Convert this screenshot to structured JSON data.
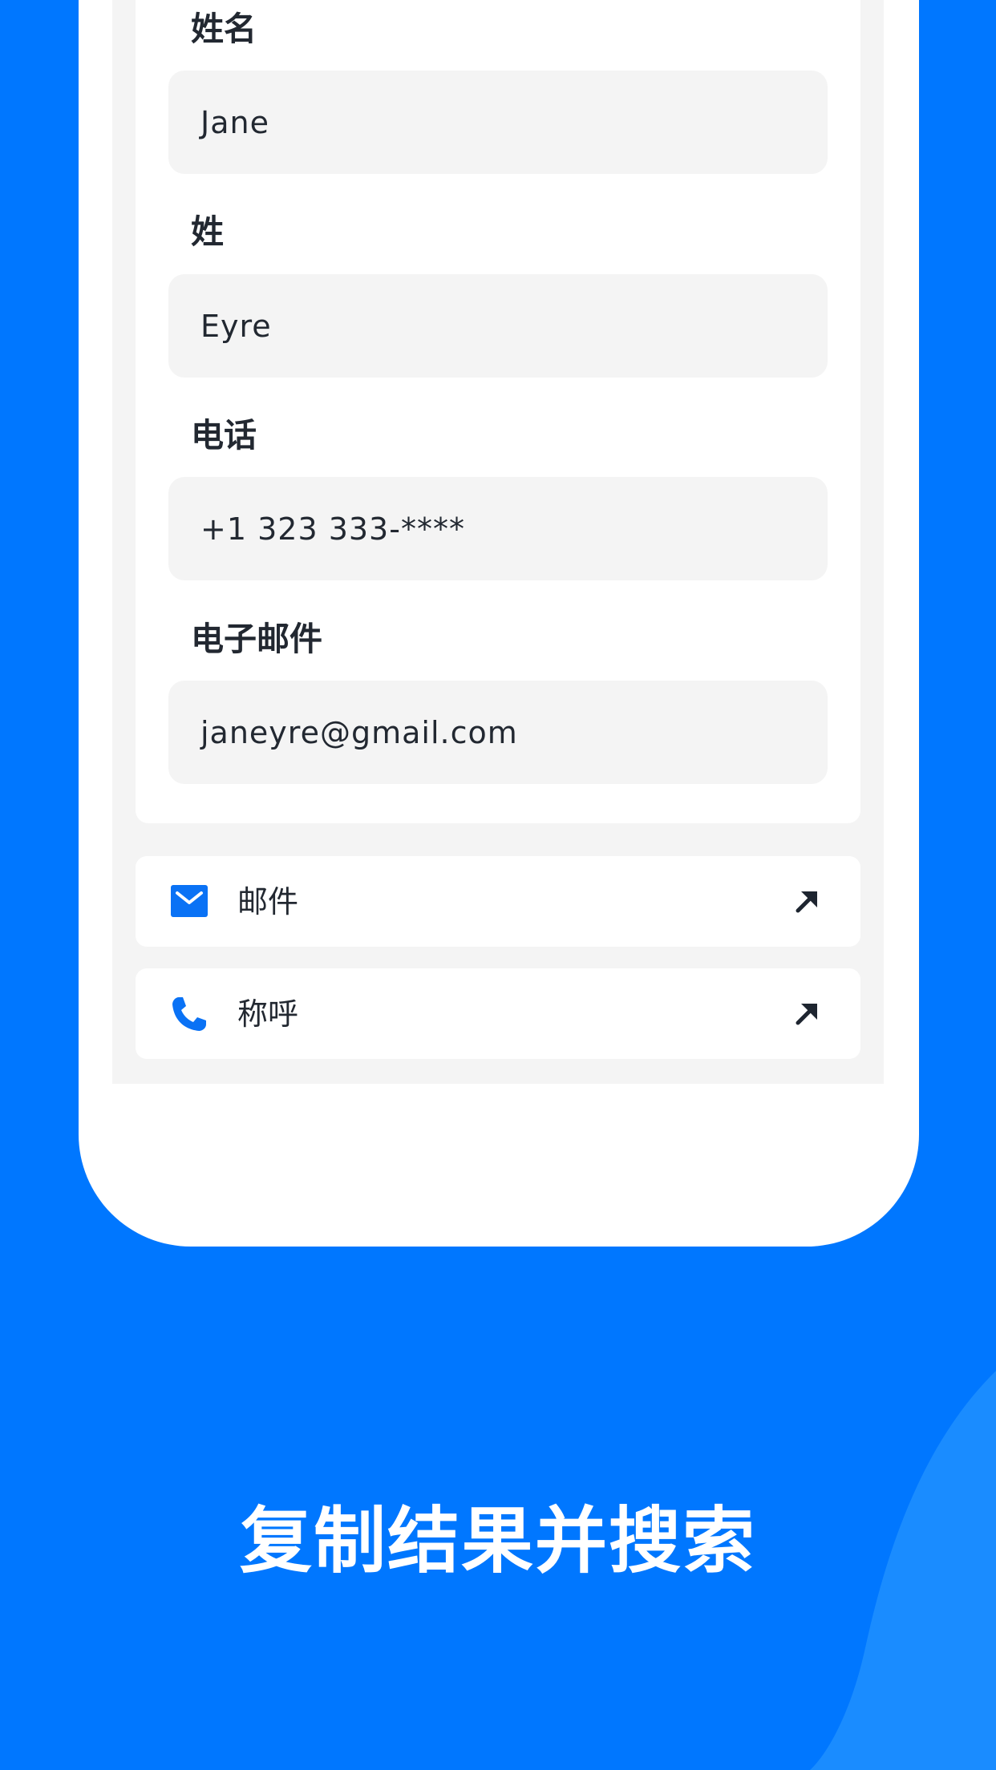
{
  "colors": {
    "background": "#0077FF",
    "wave": "#1A8CFF",
    "accent_icon": "#0A72F5",
    "text": "#222831",
    "field_bg": "#F4F4F4"
  },
  "form": {
    "fields": [
      {
        "label": "姓名",
        "value": "Jane"
      },
      {
        "label": "姓",
        "value": "Eyre"
      },
      {
        "label": "电话",
        "value": "+1 323 333-****"
      },
      {
        "label": "电子邮件",
        "value": "janeyre@gmail.com"
      }
    ]
  },
  "actions": [
    {
      "label": "邮件",
      "icon": "mail-icon",
      "trailing_icon": "open-arrow-icon"
    },
    {
      "label": "称呼",
      "icon": "phone-icon",
      "trailing_icon": "open-arrow-icon"
    }
  ],
  "caption": "复制结果并搜索"
}
